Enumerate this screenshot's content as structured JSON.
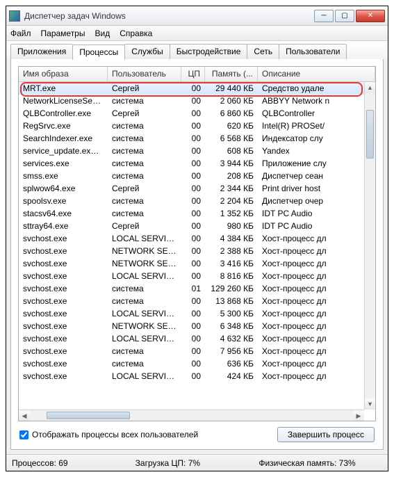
{
  "window": {
    "title": "Диспетчер задач Windows"
  },
  "menu": {
    "items": [
      "Файл",
      "Параметры",
      "Вид",
      "Справка"
    ]
  },
  "tabs": {
    "items": [
      "Приложения",
      "Процессы",
      "Службы",
      "Быстродействие",
      "Сеть",
      "Пользователи"
    ],
    "active": 1
  },
  "columns": [
    "Имя образа",
    "Пользователь",
    "ЦП",
    "Память (...",
    "Описание"
  ],
  "rows": [
    {
      "img": "MRT.exe",
      "user": "Сергей",
      "cpu": "00",
      "mem": "29 440 КБ",
      "desc": "Средство удале",
      "sel": true
    },
    {
      "img": "NetworkLicenseServ...",
      "user": "система",
      "cpu": "00",
      "mem": "2 060 КБ",
      "desc": "ABBYY Network n"
    },
    {
      "img": "QLBController.exe",
      "user": "Сергей",
      "cpu": "00",
      "mem": "6 860 КБ",
      "desc": "QLBController"
    },
    {
      "img": "RegSrvc.exe",
      "user": "система",
      "cpu": "00",
      "mem": "620 КБ",
      "desc": "Intel(R) PROSet/"
    },
    {
      "img": "SearchIndexer.exe",
      "user": "система",
      "cpu": "00",
      "mem": "6 568 КБ",
      "desc": "Индексатор слу"
    },
    {
      "img": "service_update.exe ...",
      "user": "система",
      "cpu": "00",
      "mem": "608 КБ",
      "desc": "Yandex"
    },
    {
      "img": "services.exe",
      "user": "система",
      "cpu": "00",
      "mem": "3 944 КБ",
      "desc": "Приложение слу"
    },
    {
      "img": "smss.exe",
      "user": "система",
      "cpu": "00",
      "mem": "208 КБ",
      "desc": "Диспетчер сеан"
    },
    {
      "img": "splwow64.exe",
      "user": "Сергей",
      "cpu": "00",
      "mem": "2 344 КБ",
      "desc": "Print driver host"
    },
    {
      "img": "spoolsv.exe",
      "user": "система",
      "cpu": "00",
      "mem": "2 204 КБ",
      "desc": "Диспетчер очер"
    },
    {
      "img": "stacsv64.exe",
      "user": "система",
      "cpu": "00",
      "mem": "1 352 КБ",
      "desc": "IDT PC Audio"
    },
    {
      "img": "sttray64.exe",
      "user": "Сергей",
      "cpu": "00",
      "mem": "980 КБ",
      "desc": "IDT PC Audio"
    },
    {
      "img": "svchost.exe",
      "user": "LOCAL SERVICE",
      "cpu": "00",
      "mem": "4 384 КБ",
      "desc": "Хост-процесс дл"
    },
    {
      "img": "svchost.exe",
      "user": "NETWORK SERVI...",
      "cpu": "00",
      "mem": "2 388 КБ",
      "desc": "Хост-процесс дл"
    },
    {
      "img": "svchost.exe",
      "user": "NETWORK SERVI...",
      "cpu": "00",
      "mem": "3 416 КБ",
      "desc": "Хост-процесс дл"
    },
    {
      "img": "svchost.exe",
      "user": "LOCAL SERVICE",
      "cpu": "00",
      "mem": "8 816 КБ",
      "desc": "Хост-процесс дл"
    },
    {
      "img": "svchost.exe",
      "user": "система",
      "cpu": "01",
      "mem": "129 260 КБ",
      "desc": "Хост-процесс дл"
    },
    {
      "img": "svchost.exe",
      "user": "система",
      "cpu": "00",
      "mem": "13 868 КБ",
      "desc": "Хост-процесс дл"
    },
    {
      "img": "svchost.exe",
      "user": "LOCAL SERVICE",
      "cpu": "00",
      "mem": "5 300 КБ",
      "desc": "Хост-процесс дл"
    },
    {
      "img": "svchost.exe",
      "user": "NETWORK SERVI...",
      "cpu": "00",
      "mem": "6 348 КБ",
      "desc": "Хост-процесс дл"
    },
    {
      "img": "svchost.exe",
      "user": "LOCAL SERVICE",
      "cpu": "00",
      "mem": "4 632 КБ",
      "desc": "Хост-процесс дл"
    },
    {
      "img": "svchost.exe",
      "user": "система",
      "cpu": "00",
      "mem": "7 956 КБ",
      "desc": "Хост-процесс дл"
    },
    {
      "img": "svchost.exe",
      "user": "система",
      "cpu": "00",
      "mem": "636 КБ",
      "desc": "Хост-процесс дл"
    },
    {
      "img": "svchost.exe",
      "user": "LOCAL SERVICE",
      "cpu": "00",
      "mem": "424 КБ",
      "desc": "Хост-процесс дл"
    }
  ],
  "checkbox": {
    "label": "Отображать процессы всех пользователей",
    "checked": true
  },
  "button": {
    "end": "Завершить процесс"
  },
  "status": {
    "procs": "Процессов: 69",
    "cpu": "Загрузка ЦП: 7%",
    "mem": "Физическая память: 73%"
  }
}
